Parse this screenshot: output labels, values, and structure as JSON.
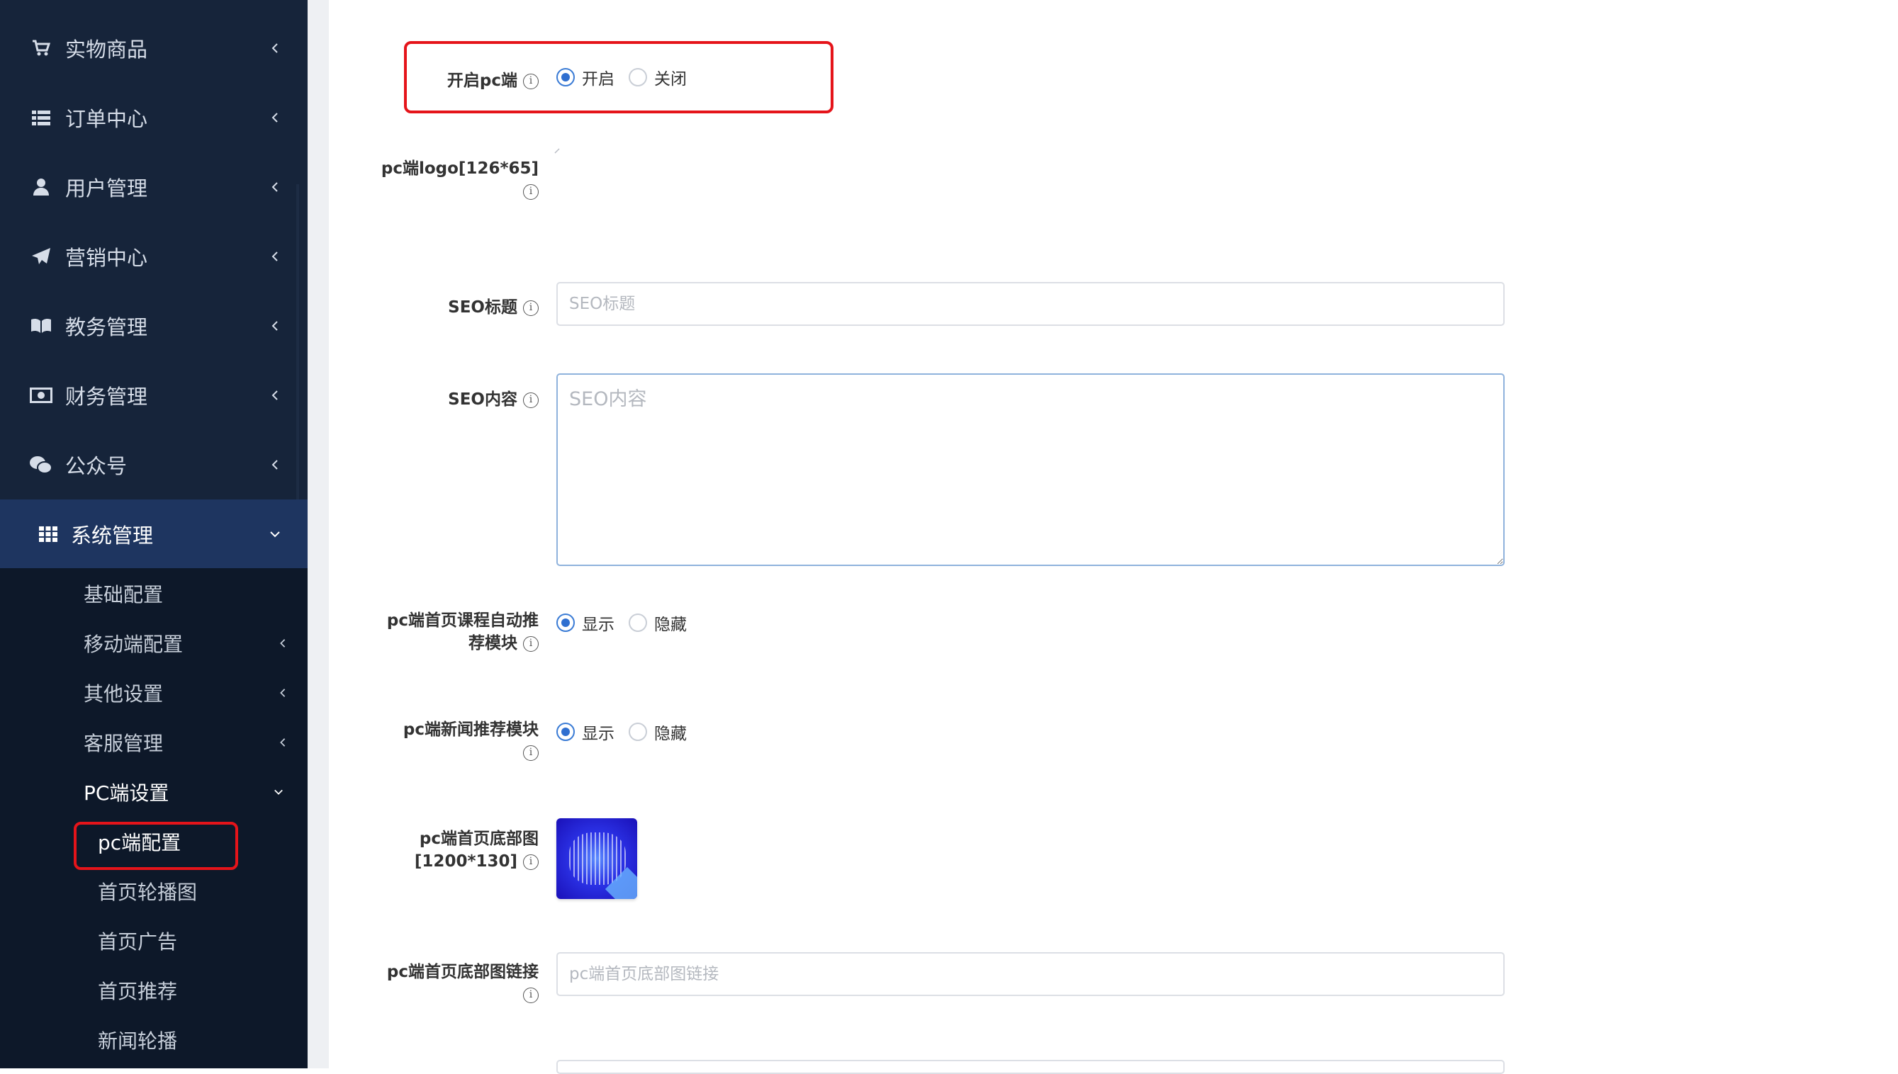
{
  "sidebar": {
    "items": [
      {
        "label": "实物商品",
        "icon": "cart-icon"
      },
      {
        "label": "订单中心",
        "icon": "list-icon"
      },
      {
        "label": "用户管理",
        "icon": "user-icon"
      },
      {
        "label": "营销中心",
        "icon": "paper-plane-icon"
      },
      {
        "label": "教务管理",
        "icon": "book-icon"
      },
      {
        "label": "财务管理",
        "icon": "money-icon"
      },
      {
        "label": "公众号",
        "icon": "wechat-icon"
      },
      {
        "label": "系统管理",
        "icon": "grid-icon",
        "active": true
      }
    ],
    "subitems": [
      {
        "label": "基础配置"
      },
      {
        "label": "移动端配置"
      },
      {
        "label": "其他设置"
      },
      {
        "label": "客服管理"
      },
      {
        "label": "PC端设置"
      },
      {
        "label": "pc端配置"
      },
      {
        "label": "首页轮播图"
      },
      {
        "label": "首页广告"
      },
      {
        "label": "首页推荐"
      },
      {
        "label": "新闻轮播"
      }
    ]
  },
  "form": {
    "open_pc": {
      "label": "开启pc端",
      "options": [
        "开启",
        "关闭"
      ],
      "selected": "开启"
    },
    "pc_logo": {
      "label": "pc端logo[126*65]"
    },
    "seo_title": {
      "label": "SEO标题",
      "placeholder": "SEO标题",
      "value": ""
    },
    "seo_content": {
      "label": "SEO内容",
      "placeholder": "SEO内容",
      "value": ""
    },
    "course_recommend": {
      "label_line1": "pc端首页课程自动推",
      "label_line2": "荐模块",
      "options": [
        "显示",
        "隐藏"
      ],
      "selected": "显示"
    },
    "news_recommend": {
      "label": "pc端新闻推荐模块",
      "options": [
        "显示",
        "隐藏"
      ],
      "selected": "显示"
    },
    "bottom_image": {
      "label_line1": "pc端首页底部图",
      "label_line2": "[1200*130]"
    },
    "bottom_link": {
      "label": "pc端首页底部图链接",
      "placeholder": "pc端首页底部图链接",
      "value": ""
    }
  },
  "info_icon": "i",
  "colors": {
    "sidebar_bg": "#16243a",
    "submenu_bg": "#0d1829",
    "active_bg": "#1e3560",
    "accent": "#2f6fd0",
    "highlight": "#e5141a"
  }
}
